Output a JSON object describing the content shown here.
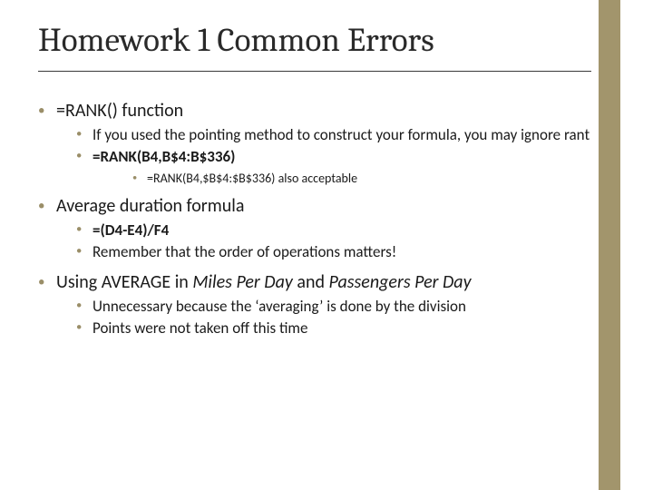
{
  "title": "Homework 1 Common Errors",
  "bullets": {
    "b1": "=RANK() function",
    "b1_1": "If you used the pointing method to construct your formula, you may ignore rant",
    "b1_2": "=RANK(B4,B$4:B$336)",
    "b1_2_1": "=RANK(B4,$B$4:$B$336) also acceptable",
    "b2": "Average duration formula",
    "b2_1": "=(D4-E4)/F4",
    "b2_2": "Remember that the order of operations matters!",
    "b3_pre": "Using AVERAGE in ",
    "b3_i1": "Miles Per Day",
    "b3_mid": " and ",
    "b3_i2": "Passengers Per Day",
    "b3_1": "Unnecessary because the ‘averaging’ is done by the division",
    "b3_2": "Points were not taken off this time"
  }
}
